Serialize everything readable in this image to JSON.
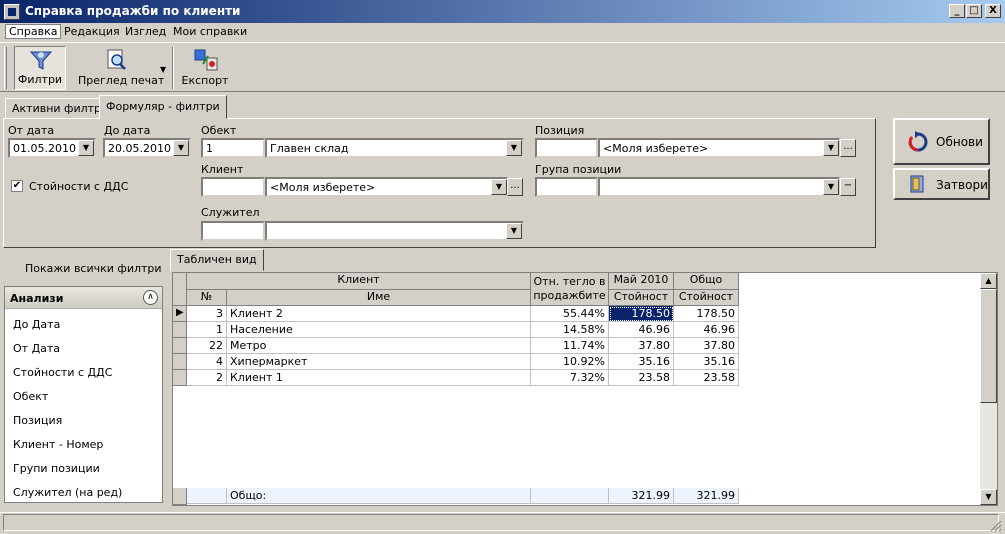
{
  "window": {
    "title": "Справка продажби по клиенти",
    "min": "_",
    "max": "□",
    "close": "X"
  },
  "menu": [
    "Справка",
    "Редакция",
    "Изглед",
    "Мои справки"
  ],
  "toolbar": {
    "filters": "Филтри",
    "print_preview": "Преглед печат",
    "export": "Експорт"
  },
  "tabs": {
    "active_filters": "Активни филтри",
    "form_filters": "Формуляр - филтри"
  },
  "form": {
    "from_date_label": "От дата",
    "from_date": "01.05.2010",
    "to_date_label": "До дата",
    "to_date": "20.05.2010",
    "vat_label": "Стойности с ДДС",
    "vat_checked": true,
    "object_label": "Обект",
    "object_code": "1",
    "object_name": "Главен склад",
    "client_label": "Клиент",
    "client_code": "",
    "client_name": "<Моля изберете>",
    "employee_label": "Служител",
    "employee_code": "",
    "employee_name": "",
    "position_label": "Позиция",
    "position_code": "",
    "position_name": "<Моля изберете>",
    "group_label": "Група позиции",
    "group_code": "",
    "group_name": ""
  },
  "buttons": {
    "refresh": "Обнови",
    "close": "Затвори",
    "more": "...",
    "minus": "−"
  },
  "left": {
    "show_all": "Покажи всички филтри",
    "section_title": "Анализи",
    "items": [
      "До Дата",
      "От Дата",
      "Стойности с ДДС",
      "Обект",
      "Позиция",
      "Клиент - Номер",
      "Групи позиции",
      "Служител (на ред)"
    ]
  },
  "grid": {
    "tab": "Табличен вид",
    "group_header_client": "Клиент",
    "header_share": "Отн. тегло в продажбите",
    "header_month": "Май 2010",
    "header_total": "Общо",
    "col_no": "№",
    "col_name": "Име",
    "col_value": "Стойност",
    "col_value2": "Стойност",
    "rows": [
      {
        "no": "3",
        "name": "Клиент 2",
        "share": "55.44%",
        "may": "178.50",
        "total": "178.50"
      },
      {
        "no": "1",
        "name": "Население",
        "share": "14.58%",
        "may": "46.96",
        "total": "46.96"
      },
      {
        "no": "22",
        "name": "Метро",
        "share": "11.74%",
        "may": "37.80",
        "total": "37.80"
      },
      {
        "no": "4",
        "name": "Хипермаркет",
        "share": "10.92%",
        "may": "35.16",
        "total": "35.16"
      },
      {
        "no": "2",
        "name": "Клиент 1",
        "share": "7.32%",
        "may": "23.58",
        "total": "23.58"
      }
    ],
    "footer_label": "Общо:",
    "footer_may": "321.99",
    "footer_total": "321.99"
  }
}
